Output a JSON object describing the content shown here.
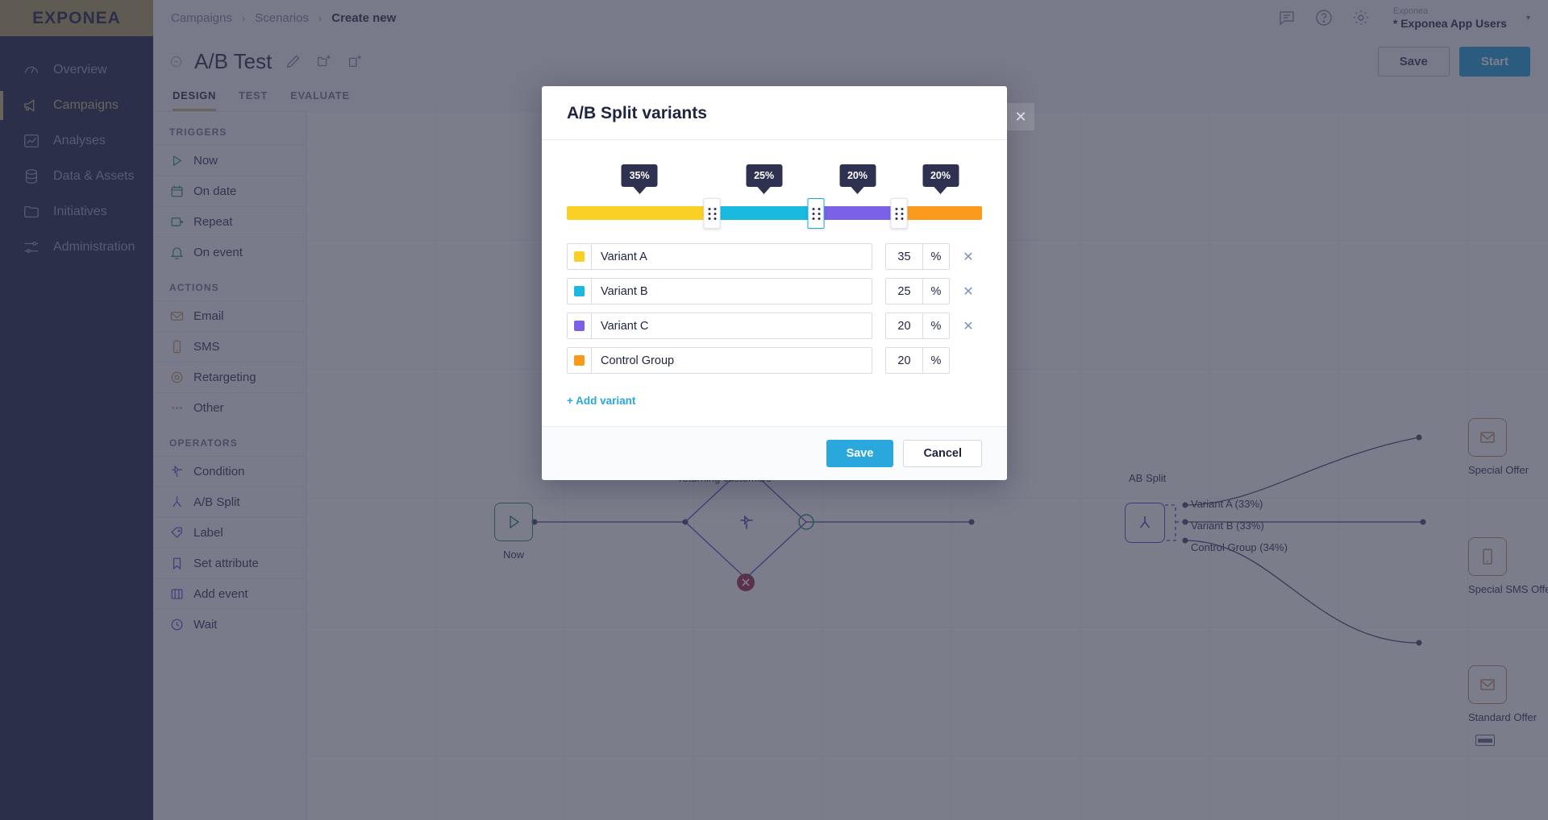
{
  "brand": {
    "logo": "EXPONEA"
  },
  "sidebar": {
    "items": [
      {
        "label": "Overview",
        "icon": "gauge-icon"
      },
      {
        "label": "Campaigns",
        "icon": "megaphone-icon"
      },
      {
        "label": "Analyses",
        "icon": "chart-icon"
      },
      {
        "label": "Data & Assets",
        "icon": "database-icon"
      },
      {
        "label": "Initiatives",
        "icon": "folder-icon"
      },
      {
        "label": "Administration",
        "icon": "sliders-icon"
      }
    ]
  },
  "topbar": {
    "breadcrumbs": [
      "Campaigns",
      "Scenarios",
      "Create new"
    ],
    "separator": "›",
    "icons": [
      "chat-icon",
      "help-icon",
      "gear-icon"
    ],
    "account": {
      "org": "Exponea",
      "project": "* Exponea App Users",
      "caret": "▾"
    }
  },
  "header": {
    "title": "A/B Test",
    "icons": [
      "pencil-icon",
      "new-folder-icon",
      "export-icon"
    ],
    "save_label": "Save",
    "start_label": "Start",
    "tabs": [
      {
        "label": "DESIGN",
        "active": true
      },
      {
        "label": "TEST",
        "active": false
      },
      {
        "label": "EVALUATE",
        "active": false
      }
    ]
  },
  "palette": {
    "groups": [
      {
        "title": "TRIGGERS",
        "items": [
          {
            "label": "Now",
            "icon": "play-icon",
            "color": "#3c8f7e"
          },
          {
            "label": "On date",
            "icon": "calendar-icon",
            "color": "#3c8f7e"
          },
          {
            "label": "Repeat",
            "icon": "repeat-icon",
            "color": "#3c8f7e"
          },
          {
            "label": "On event",
            "icon": "bell-icon",
            "color": "#3c8f7e"
          }
        ]
      },
      {
        "title": "ACTIONS",
        "items": [
          {
            "label": "Email",
            "icon": "envelope-icon",
            "color": "#c69a6b"
          },
          {
            "label": "SMS",
            "icon": "phone-icon",
            "color": "#c69a6b"
          },
          {
            "label": "Retargeting",
            "icon": "target-icon",
            "color": "#c69a6b"
          },
          {
            "label": "Other",
            "icon": "dots-icon",
            "color": "#c69a6b"
          }
        ]
      },
      {
        "title": "OPERATORS",
        "items": [
          {
            "label": "Condition",
            "icon": "condition-icon",
            "color": "#5a52c9"
          },
          {
            "label": "A/B Split",
            "icon": "split-icon",
            "color": "#5a52c9"
          },
          {
            "label": "Label",
            "icon": "tag-icon",
            "color": "#5a52c9"
          },
          {
            "label": "Set attribute",
            "icon": "bookmark-icon",
            "color": "#5a52c9"
          },
          {
            "label": "Add event",
            "icon": "film-icon",
            "color": "#5a52c9"
          },
          {
            "label": "Wait",
            "icon": "clock-icon",
            "color": "#5a52c9"
          }
        ]
      }
    ]
  },
  "canvas": {
    "nodes": [
      {
        "id": "now",
        "label": "Now",
        "icon": "play-icon",
        "color": "green"
      },
      {
        "id": "condition",
        "label": "returning customers",
        "icon": "condition-icon",
        "color": "purple"
      },
      {
        "id": "absplit",
        "label": "AB Split",
        "icon": "split-icon",
        "color": "purple"
      },
      {
        "id": "special-offer",
        "label": "Special Offer",
        "icon": "envelope-icon",
        "color": "orange"
      },
      {
        "id": "special-sms-offer",
        "label": "Special SMS Offer",
        "icon": "phone-icon",
        "color": "orange"
      },
      {
        "id": "standard-offer",
        "label": "Standard Offer",
        "icon": "envelope-icon",
        "color": "orange"
      }
    ],
    "branch_labels": [
      "Variant A (33%)",
      "Variant B (33%)",
      "Control Group (34%)"
    ]
  },
  "modal": {
    "title": "A/B Split variants",
    "close_label": "✕",
    "add_variant_label": "+ Add variant",
    "percent_sign": "%",
    "delete_label": "✕",
    "save_label": "Save",
    "cancel_label": "Cancel",
    "variants": [
      {
        "name": "Variant A",
        "percent": "35",
        "badge": "35%",
        "color": "#fbd024",
        "removable": true
      },
      {
        "name": "Variant B",
        "percent": "25",
        "badge": "25%",
        "color": "#1ab9e0",
        "removable": true
      },
      {
        "name": "Variant C",
        "percent": "20",
        "badge": "20%",
        "color": "#7b61e8",
        "removable": true
      },
      {
        "name": "Control Group",
        "percent": "20",
        "badge": "20%",
        "color": "#f99a1c",
        "removable": false
      }
    ],
    "handles": [
      {
        "at": "35",
        "selected": false
      },
      {
        "at": "60",
        "selected": true
      },
      {
        "at": "80",
        "selected": false
      }
    ]
  },
  "colors": {
    "accent": "#2aa7dd",
    "brand_gold": "#c9bd86",
    "sidebar_bg": "#2b3150",
    "badge_bg": "#2f3150"
  }
}
